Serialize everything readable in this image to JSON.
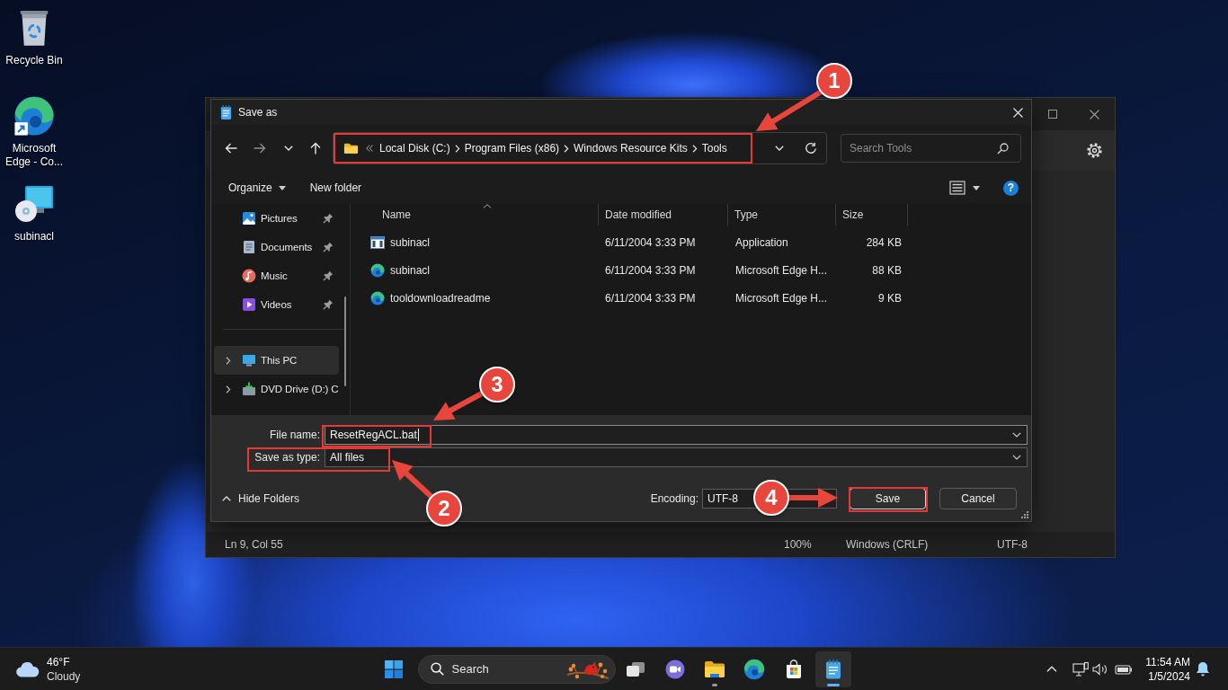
{
  "desktop_icons": [
    {
      "label": "Recycle Bin",
      "kind": "recycle-bin"
    },
    {
      "label": "Microsoft Edge - Co...",
      "kind": "edge-shortcut"
    },
    {
      "label": "subinacl",
      "kind": "installer"
    }
  ],
  "notepad": {
    "status_bar": [
      "Ln 9, Col 55",
      "100%",
      "Windows (CRLF)",
      "UTF-8"
    ]
  },
  "dialog": {
    "title": "Save as",
    "address": {
      "breadcrumbs": [
        "Local Disk (C:)",
        "Program Files (x86)",
        "Windows Resource Kits",
        "Tools"
      ]
    },
    "search": {
      "placeholder": "Search Tools"
    },
    "toolbar": {
      "organize": "Organize",
      "new_folder": "New folder",
      "help": "?"
    },
    "nav_pane": {
      "quick_access": [
        {
          "label": "Pictures",
          "kind": "pictures",
          "selected": false
        },
        {
          "label": "Documents",
          "kind": "documents",
          "selected": false
        },
        {
          "label": "Music",
          "kind": "music",
          "selected": false
        },
        {
          "label": "Videos",
          "kind": "videos",
          "selected": false
        }
      ],
      "locations": [
        {
          "label": "This PC",
          "kind": "pc",
          "selected": true,
          "expanded": false
        },
        {
          "label": "DVD Drive (D:) C",
          "kind": "dvd",
          "selected": false,
          "expanded": false
        }
      ]
    },
    "file_list": {
      "columns": [
        {
          "label": "Name",
          "sorted": true
        },
        {
          "label": "Date modified",
          "sorted": false
        },
        {
          "label": "Type",
          "sorted": false
        },
        {
          "label": "Size",
          "sorted": false
        }
      ],
      "rows": [
        {
          "name": "subinacl",
          "kind": "application",
          "date_modified": "6/11/2004 3:33 PM",
          "type": "Application",
          "size": "284 KB"
        },
        {
          "name": "subinacl",
          "kind": "edge-document",
          "date_modified": "6/11/2004 3:33 PM",
          "type": "Microsoft Edge H...",
          "size": "88 KB"
        },
        {
          "name": "tooldownloadreadme",
          "kind": "edge-document",
          "date_modified": "6/11/2004 3:33 PM",
          "type": "Microsoft Edge H...",
          "size": "9 KB"
        }
      ]
    },
    "file_name": {
      "label": "File name:",
      "value": "ResetRegACL.bat",
      "focused": true
    },
    "save_as_type": {
      "label": "Save as type:",
      "value": "All files"
    },
    "hide_folders": "Hide Folders",
    "encoding": {
      "label": "Encoding:",
      "value": "UTF-8"
    },
    "buttons": [
      {
        "label": "Save",
        "kind": "default"
      },
      {
        "label": "Cancel",
        "kind": "normal"
      }
    ]
  },
  "callouts": [
    "1",
    "2",
    "3",
    "4"
  ],
  "taskbar": {
    "weather": {
      "temperature": "46°F",
      "condition": "Cloudy"
    },
    "search": {
      "placeholder": "Search"
    },
    "apps": [
      {
        "kind": "task-view",
        "running": false,
        "active": false
      },
      {
        "kind": "chat",
        "running": false,
        "active": false
      },
      {
        "kind": "file-explorer",
        "running": true,
        "active": false
      },
      {
        "kind": "edge",
        "running": false,
        "active": false
      },
      {
        "kind": "store",
        "running": false,
        "active": false
      },
      {
        "kind": "notepad",
        "running": true,
        "active": true
      }
    ],
    "clock": {
      "time": "11:54 AM",
      "date": "1/5/2024"
    }
  }
}
